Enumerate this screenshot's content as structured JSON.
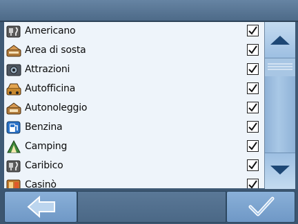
{
  "poi_list": [
    {
      "label": "Americano",
      "icon": "restaurant-icon",
      "checked": true
    },
    {
      "label": "Area di sosta",
      "icon": "rest-area-icon",
      "checked": true
    },
    {
      "label": "Attrazioni",
      "icon": "camera-icon",
      "checked": true
    },
    {
      "label": "Autofficina",
      "icon": "garage-icon",
      "checked": true
    },
    {
      "label": "Autonoleggio",
      "icon": "car-rental-icon",
      "checked": true
    },
    {
      "label": "Benzina",
      "icon": "fuel-pump-icon",
      "checked": true
    },
    {
      "label": "Camping",
      "icon": "tent-icon",
      "checked": true
    },
    {
      "label": "Caribico",
      "icon": "restaurant-icon",
      "checked": true
    },
    {
      "label": "Casinò",
      "icon": "casino-icon",
      "checked": true
    }
  ],
  "scrollbar": {
    "up_icon": "arrow-up-icon",
    "down_icon": "arrow-down-icon"
  },
  "colors": {
    "accent": "#7aa3cf",
    "background": "#3f5a76",
    "list_bg": "#eef4fa"
  }
}
